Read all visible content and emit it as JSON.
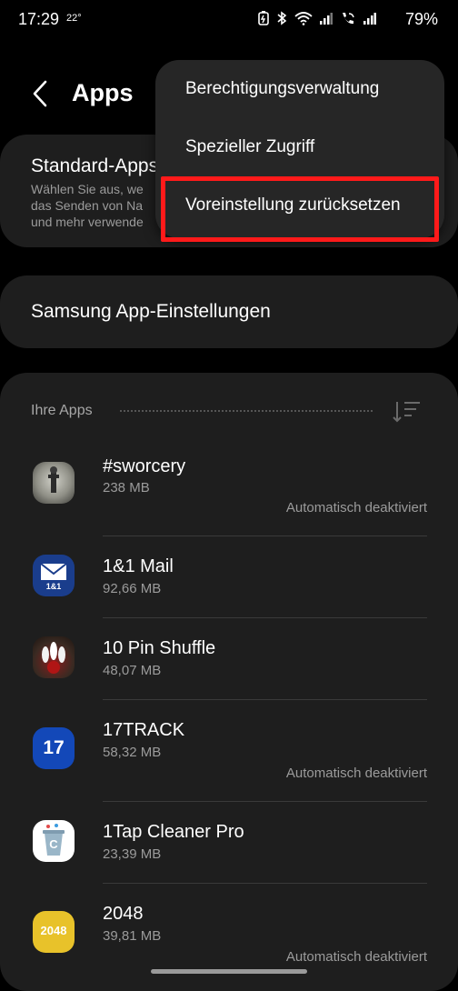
{
  "status_bar": {
    "time": "17:29",
    "temperature": "22°",
    "battery": "79%",
    "icons": [
      "battery-saver-icon",
      "bluetooth-icon",
      "wifi-icon",
      "signal-icon",
      "wifi-calling-icon",
      "signal-icon"
    ]
  },
  "header": {
    "title": "Apps",
    "back_icon": "back-arrow-icon"
  },
  "standard_apps": {
    "title": "Standard-Apps",
    "description": "Wählen Sie aus, we\ndas Senden von Na\nund mehr verwende"
  },
  "samsung_settings": {
    "title": "Samsung App-Einstellungen"
  },
  "apps_section": {
    "header": "Ihre Apps",
    "sort_icon": "sort-icon"
  },
  "apps": [
    {
      "name": "#sworcery",
      "size": "238 MB",
      "status": "Automatisch deaktiviert",
      "icon": "sworcery-icon"
    },
    {
      "name": "1&1 Mail",
      "size": "92,66 MB",
      "status": "",
      "icon": "mail-icon",
      "icon_label": "1&1"
    },
    {
      "name": "10 Pin Shuffle",
      "size": "48,07 MB",
      "status": "",
      "icon": "bowling-icon"
    },
    {
      "name": "17TRACK",
      "size": "58,32 MB",
      "status": "Automatisch deaktiviert",
      "icon": "17track-icon",
      "icon_label": "17"
    },
    {
      "name": "1Tap Cleaner Pro",
      "size": "23,39 MB",
      "status": "",
      "icon": "cleaner-icon",
      "icon_label": "C"
    },
    {
      "name": "2048",
      "size": "39,81 MB",
      "status": "Automatisch deaktiviert",
      "icon": "2048-icon",
      "icon_label": "2048"
    }
  ],
  "menu": {
    "items": [
      "Berechtigungsverwaltung",
      "Spezieller Zugriff",
      "Voreinstellung zurücksetzen"
    ],
    "highlight_color": "#ff1a1a"
  }
}
